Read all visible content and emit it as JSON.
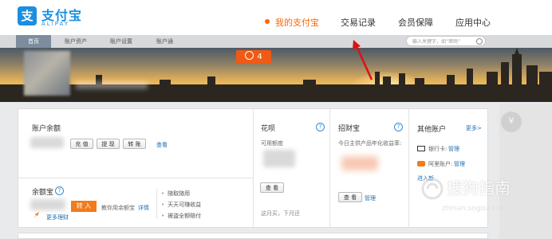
{
  "header": {
    "logo_mark": "支",
    "logo_text": "支付宝",
    "logo_sub": "ALIPAY",
    "nav": [
      "我的支付宝",
      "交易记录",
      "会员保障",
      "应用中心"
    ]
  },
  "subnav": {
    "items": [
      "首页",
      "账户资产",
      "账户设置",
      "账户通"
    ],
    "search_placeholder": "输入关键字，如“密码”"
  },
  "banner": {
    "badge_count": "4"
  },
  "balance": {
    "title": "账户余额",
    "recharge": "充 值",
    "withdraw": "提 现",
    "transfer": "转 账",
    "view": "查看"
  },
  "yuebao": {
    "title": "余额宝",
    "help": "?",
    "transfer_in": "转 入",
    "desc": "教你用余额宝",
    "detail": "详情",
    "more": "更多理财",
    "bullets": [
      "随取随用",
      "天天可赚收益",
      "被盗全额赔付"
    ]
  },
  "huabei": {
    "title": "花呗",
    "help": "?",
    "available": "可用额度",
    "view_btn": "查 看",
    "note": "这月买，下月还"
  },
  "zhaocaibao": {
    "title": "招财宝",
    "help": "?",
    "desc": "今日主供产品年化收益率:",
    "view_btn": "查 看",
    "manage": "管理"
  },
  "other": {
    "title": "其他账户",
    "more": "更多>",
    "bank_label": "银行卡:",
    "bank_manage": "管理",
    "ali_label": "阿里账户:",
    "ali_manage": "管理",
    "cross": "进入新"
  },
  "watermark": {
    "cn": "搜狗指南",
    "en": "zhinan.sogou.com"
  },
  "side": {
    "icon_text": "￥"
  }
}
